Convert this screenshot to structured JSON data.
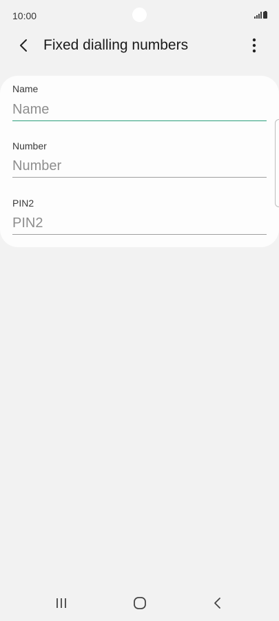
{
  "status_bar": {
    "time": "10:00"
  },
  "app_bar": {
    "title": "Fixed dialling numbers",
    "back_icon": "chevron-left-icon",
    "more_icon": "more-vertical-icon"
  },
  "form": {
    "fields": [
      {
        "label": "Name",
        "placeholder": "Name",
        "value": ""
      },
      {
        "label": "Number",
        "placeholder": "Number",
        "value": ""
      },
      {
        "label": "PIN2",
        "placeholder": "PIN2",
        "value": ""
      }
    ]
  },
  "colors": {
    "background": "#f2f2f2",
    "card": "#fdfdfd",
    "focus_underline": "#2a9d7a",
    "underline": "#9e9e9e",
    "placeholder": "#8e8e8e"
  },
  "nav_bar": {
    "recents_icon": "recents-icon",
    "home_icon": "home-icon",
    "back_icon": "back-icon"
  }
}
